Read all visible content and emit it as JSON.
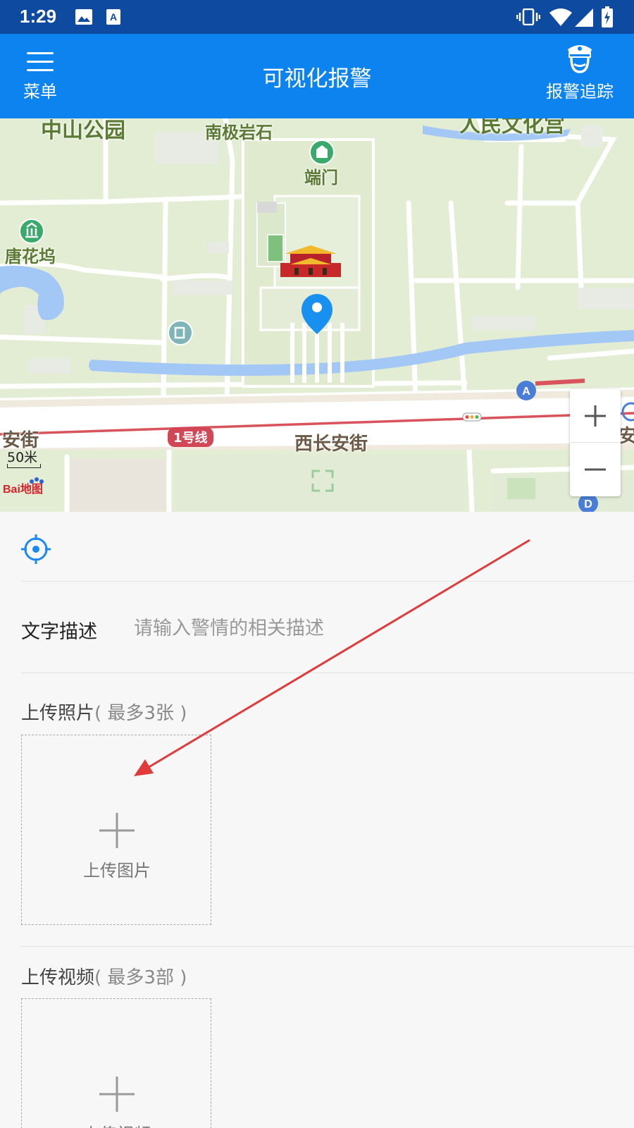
{
  "status_bar": {
    "time": "1:29",
    "icons": [
      "image-icon",
      "text-a-icon",
      "vibrate-icon",
      "wifi-icon",
      "signal-icon",
      "battery-charging-icon"
    ]
  },
  "app_bar": {
    "menu_label": "菜单",
    "title": "可视化报警",
    "track_label": "报警追踪",
    "background": "#0c83ee"
  },
  "map": {
    "labels": {
      "park": "中山公园",
      "rock": "南极岩石",
      "gate": "端门",
      "tanghuawu": "唐花坞",
      "culture": "人民文化宫",
      "street": "西长安街",
      "street_left": "安街",
      "street_right": "安"
    },
    "metro_line": "1号线",
    "scale": "50米",
    "logo": "Bai地图",
    "marker_color": "#1890f0"
  },
  "form": {
    "description_label": "文字描述",
    "description_placeholder": "请输入警情的相关描述",
    "description_value": "",
    "photo_section_title": "上传照片",
    "photo_section_hint": "( 最多3张 )",
    "photo_upload_label": "上传图片",
    "video_section_title": "上传视频",
    "video_section_hint": "( 最多3部 )",
    "video_upload_label": "上传视频"
  }
}
